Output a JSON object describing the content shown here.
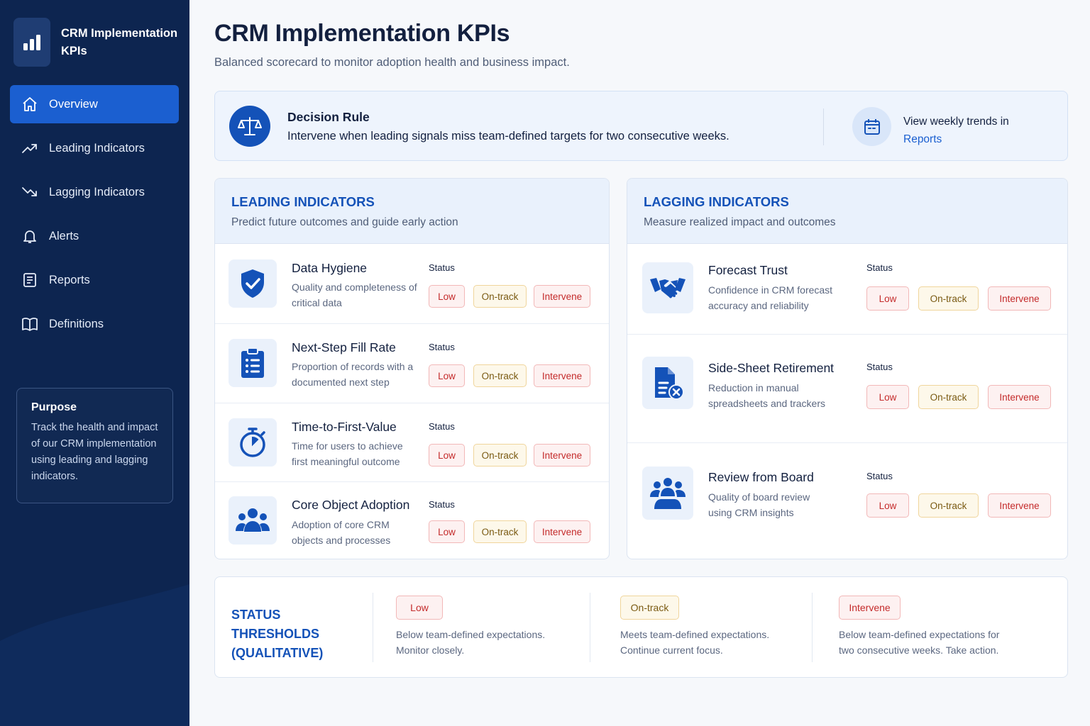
{
  "sidebar": {
    "brand_title": "CRM Implementation KPIs",
    "nav": [
      {
        "label": "Overview",
        "icon": "home-icon",
        "active": true
      },
      {
        "label": "Leading Indicators",
        "icon": "trend-up-icon"
      },
      {
        "label": "Lagging Indicators",
        "icon": "trend-down-icon"
      },
      {
        "label": "Alerts",
        "icon": "bell-icon"
      },
      {
        "label": "Reports",
        "icon": "document-icon"
      },
      {
        "label": "Definitions",
        "icon": "book-icon"
      }
    ],
    "purpose": {
      "title": "Purpose",
      "text": "Track the health and impact of our CRM implementation using leading and lagging indicators."
    }
  },
  "header": {
    "title": "CRM Implementation KPIs",
    "subtitle": "Balanced scorecard to monitor adoption health and business impact."
  },
  "decision": {
    "title": "Decision Rule",
    "text": "Intervene when leading signals miss team-defined targets for two consecutive weeks.",
    "trends_text": "View weekly trends in",
    "trends_link": "Reports"
  },
  "status_label": "Status",
  "statuses": {
    "low": "Low",
    "ontrack": "On-track",
    "intervene": "Intervene"
  },
  "leading": {
    "title": "LEADING INDICATORS",
    "subtitle": "Predict future outcomes and guide early action",
    "items": [
      {
        "title": "Data Hygiene",
        "desc": "Quality and completeness of critical data",
        "icon": "shield-check-icon"
      },
      {
        "title": "Next-Step Fill Rate",
        "desc": "Proportion of records with a documented next step",
        "icon": "clipboard-list-icon"
      },
      {
        "title": "Time-to-First-Value",
        "desc": "Time for users to achieve first meaningful outcome",
        "icon": "stopwatch-icon"
      },
      {
        "title": "Core Object Adoption",
        "desc": "Adoption of core CRM objects and processes",
        "icon": "users-icon"
      }
    ]
  },
  "lagging": {
    "title": "LAGGING INDICATORS",
    "subtitle": "Measure realized impact and outcomes",
    "items": [
      {
        "title": "Forecast Trust",
        "desc": "Confidence in CRM forecast accuracy and reliability",
        "icon": "handshake-icon"
      },
      {
        "title": "Side-Sheet Retirement",
        "desc": "Reduction in manual spreadsheets and trackers",
        "icon": "file-remove-icon"
      },
      {
        "title": "Review from Board",
        "desc": "Quality of board review using CRM insights",
        "icon": "group-icon"
      }
    ]
  },
  "thresholds": {
    "title": "STATUS THRESHOLDS (QUALITATIVE)",
    "items": [
      {
        "label": "Low",
        "text": "Below team-defined expectations. Monitor closely."
      },
      {
        "label": "On-track",
        "text": "Meets team-defined expectations. Continue current focus."
      },
      {
        "label": "Intervene",
        "text": "Below team-defined expectations for two consecutive weeks. Take action."
      }
    ]
  },
  "colors": {
    "sidebar": "#0d2550",
    "accent": "#1452b8",
    "active_nav": "#1b5fd0",
    "low": "#c42b2b",
    "ontrack": "#7a5a12",
    "intervene": "#c42b2b"
  }
}
